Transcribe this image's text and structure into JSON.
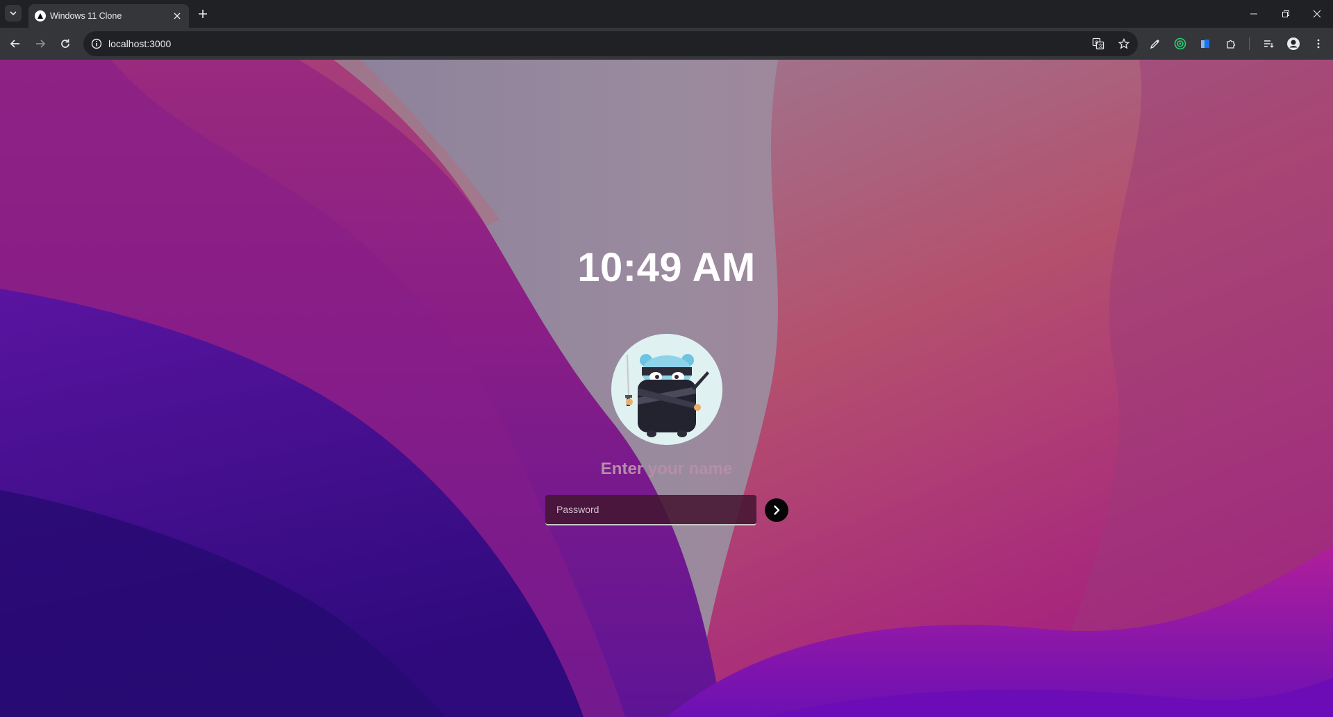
{
  "browser": {
    "tab": {
      "title": "Windows 11 Clone",
      "favicon": "triangle-logo-icon"
    },
    "address_bar": {
      "url": "localhost:3000"
    },
    "toolbar_icons": [
      "back-arrow-icon",
      "forward-arrow-icon",
      "reload-icon",
      "site-info-icon",
      "translate-icon",
      "bookmark-star-icon",
      "eyedropper-icon",
      "green-circle-extension-icon",
      "blue-book-extension-icon",
      "puzzle-extensions-icon",
      "reading-list-icon",
      "profile-icon",
      "more-menu-icon"
    ],
    "window_controls": [
      "minimize-icon",
      "restore-icon",
      "close-icon"
    ]
  },
  "lock_screen": {
    "time": "10:49 AM",
    "name_prompt": "Enter your name",
    "password_placeholder": "Password",
    "submit_icon": "chevron-right-icon",
    "avatar": "ninja-mascot-avatar"
  },
  "colors": {
    "wallpaper_purple": "#7a1f8a",
    "wallpaper_deep_indigo": "#3a0a8f",
    "wallpaper_gray": "#8f8a9e",
    "wallpaper_rose": "#b0506a",
    "name_text": "#b58ea8",
    "submit_button": "#050505"
  }
}
